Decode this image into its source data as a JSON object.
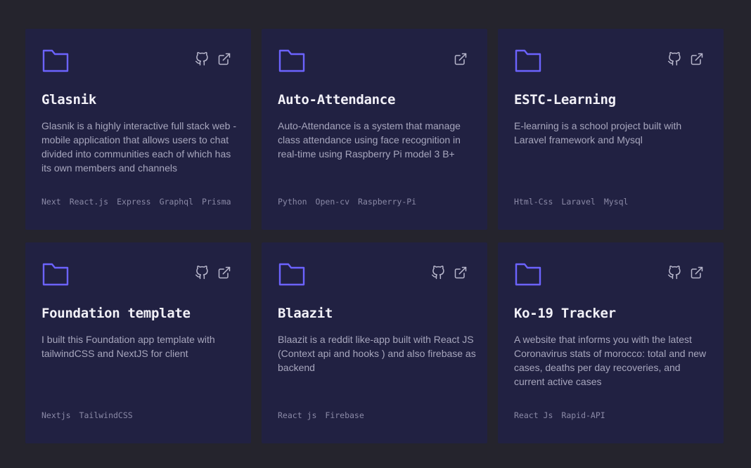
{
  "colors": {
    "page_background": "#25242d",
    "card_background": "#212142",
    "accent": "#6c63ff",
    "icon": "#b8b7cc",
    "title": "#f2f1f8",
    "description": "#a7a6bd",
    "tag": "#8a89a6"
  },
  "projects": [
    {
      "title": "Glasnik",
      "description": "Glasnik is a highly interactive full stack web - mobile application that allows users to chat divided into communities each of which has its own members and channels",
      "tags": [
        "Next",
        "React.js",
        "Express",
        "Graphql",
        "Prisma"
      ],
      "icons": [
        "folder-icon",
        "github-icon",
        "external-link-icon"
      ]
    },
    {
      "title": "Auto-Attendance",
      "description": "Auto-Attendance is a system that manage class attendance using face recognition in real-time using Raspberry Pi model 3 B+",
      "tags": [
        "Python",
        "Open-cv",
        "Raspberry-Pi"
      ],
      "icons": [
        "folder-icon",
        "external-link-icon"
      ]
    },
    {
      "title": "ESTC-Learning",
      "description": "E-learning is a school project built with Laravel framework and Mysql",
      "tags": [
        "Html-Css",
        "Laravel",
        "Mysql"
      ],
      "icons": [
        "folder-icon",
        "github-icon",
        "external-link-icon"
      ]
    },
    {
      "title": "Foundation template",
      "description": "I built this Foundation app template with tailwindCSS and NextJS for client",
      "tags": [
        "Nextjs",
        "TailwindCSS"
      ],
      "icons": [
        "folder-icon",
        "github-icon",
        "external-link-icon"
      ]
    },
    {
      "title": "Blaazit",
      "description": "Blaazit is a reddit like-app built with React JS (Context api and hooks ) and also firebase as backend",
      "tags": [
        "React js",
        "Firebase"
      ],
      "icons": [
        "folder-icon",
        "github-icon",
        "external-link-icon"
      ]
    },
    {
      "title": "Ko-19 Tracker",
      "description": "A website that informs you with the latest Coronavirus stats of morocco: total and new cases, deaths per day recoveries, and current active cases",
      "tags": [
        "React Js",
        "Rapid-API"
      ],
      "icons": [
        "folder-icon",
        "github-icon",
        "external-link-icon"
      ]
    }
  ]
}
